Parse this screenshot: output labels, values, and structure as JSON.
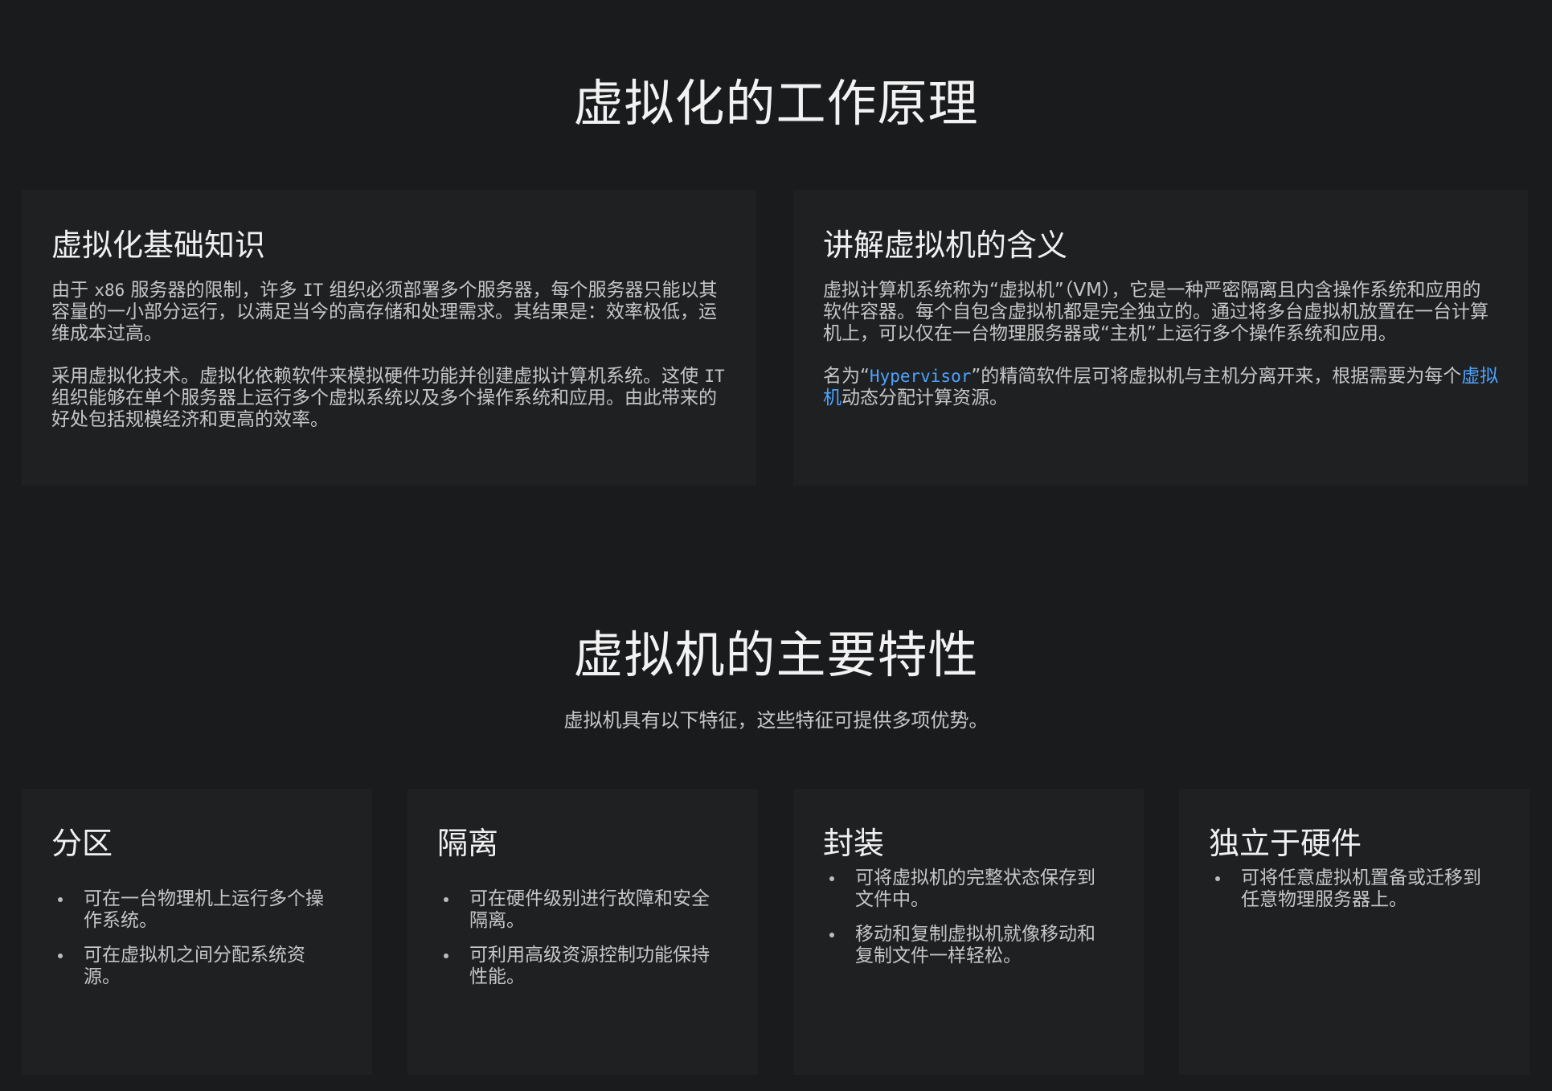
{
  "section1": {
    "title": "虚拟化的工作原理",
    "cards": [
      {
        "title": "虚拟化基础知识",
        "paragraphs": [
          {
            "parts": [
              {
                "text": "由于 ",
                "style": "normal"
              },
              {
                "text": "x86",
                "style": "code"
              },
              {
                "text": " 服务器的限制，许多 ",
                "style": "normal"
              },
              {
                "text": "IT",
                "style": "code"
              },
              {
                "text": " 组织必须部署多个服务器，每个服务器只能以其容量的一小部分运行，以满足当今的高存储和处理需求。其结果是：效率极低，运维成本过高。",
                "style": "normal"
              }
            ]
          },
          {
            "parts": [
              {
                "text": "采用虚拟化技术。虚拟化依赖软件来模拟硬件功能并创建虚拟计算机系统。这使 ",
                "style": "normal"
              },
              {
                "text": "IT",
                "style": "code"
              },
              {
                "text": " 组织能够在单个服务器上运行多个虚拟系统以及多个操作系统和应用。由此带来的好处包括规模经济和更高的效率。",
                "style": "normal"
              }
            ]
          }
        ]
      },
      {
        "title": "讲解虚拟机的含义",
        "paragraphs": [
          {
            "parts": [
              {
                "text": "虚拟计算机系统称为“虚拟机”（VM），它是一种严密隔离且内含操作系统和应用的软件容器。每个自包含虚拟机都是完全独立的。通过将多台虚拟机放置在一台计算机上，可以仅在一台物理服务器或“主机”上运行多个操作系统和应用。",
                "style": "normal"
              }
            ]
          },
          {
            "parts": [
              {
                "text": "名为“",
                "style": "normal"
              },
              {
                "text": "Hypervisor",
                "style": "code-link"
              },
              {
                "text": "”的精简软件层可将虚拟机与主机分离开来，根据需要为每个",
                "style": "normal"
              },
              {
                "text": "虚拟机",
                "style": "link"
              },
              {
                "text": "动态分配计算资源。",
                "style": "normal"
              }
            ]
          }
        ]
      }
    ]
  },
  "section2": {
    "title": "虚拟机的主要特性",
    "subtitle": "虚拟机具有以下特征，这些特征可提供多项优势。",
    "features": [
      {
        "title": "分区",
        "items": [
          "可在一台物理机上运行多个操作系统。",
          "可在虚拟机之间分配系统资源。"
        ]
      },
      {
        "title": "隔离",
        "items": [
          "可在硬件级别进行故障和安全隔离。",
          "可利用高级资源控制功能保持性能。"
        ]
      },
      {
        "title": "封装",
        "items": [
          "可将虚拟机的完整状态保存到文件中。",
          "移动和复制虚拟机就像移动和复制文件一样轻松。"
        ]
      },
      {
        "title": "独立于硬件",
        "items": [
          "可将任意虚拟机置备或迁移到任意物理服务器上。"
        ]
      }
    ]
  },
  "colors": {
    "background": "#1a1b1d",
    "card": "#1f2022",
    "link": "#4da3ff",
    "text": "#c6c6c6",
    "heading": "#f0f0f0"
  }
}
